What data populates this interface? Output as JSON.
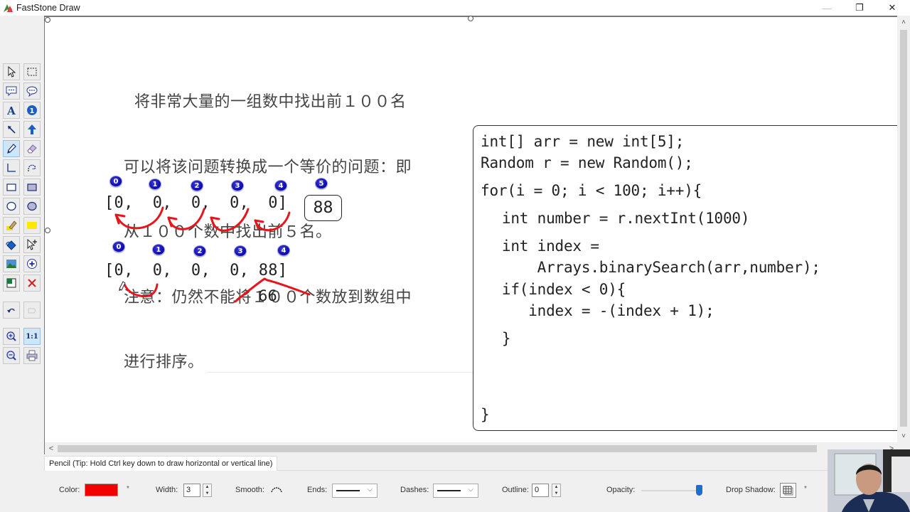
{
  "window": {
    "title": "FastStone Draw",
    "controls": {
      "minimize": "—",
      "restore": "❐",
      "close": "✕"
    }
  },
  "toolbar": {
    "tools": [
      {
        "name": "select-pointer-tool",
        "icon": "pointer-arrow-icon"
      },
      {
        "name": "rectangle-select-tool",
        "icon": "dashed-rect-select-icon"
      },
      {
        "name": "callout-rect-tool",
        "icon": "speech-bubble-rect-icon"
      },
      {
        "name": "callout-oval-tool",
        "icon": "speech-bubble-oval-icon"
      },
      {
        "name": "text-tool",
        "icon": "text-a-icon"
      },
      {
        "name": "numbered-step-tool",
        "icon": "info-circle-icon"
      },
      {
        "name": "arrow-tool",
        "icon": "diagonal-arrow-icon"
      },
      {
        "name": "block-arrow-tool",
        "icon": "up-arrow-icon"
      },
      {
        "name": "pencil-tool",
        "icon": "pencil-icon",
        "active": true
      },
      {
        "name": "eraser-tool",
        "icon": "eraser-icon"
      },
      {
        "name": "line-tool",
        "icon": "corner-line-icon"
      },
      {
        "name": "curve-tool",
        "icon": "curve-icon"
      },
      {
        "name": "rectangle-tool",
        "icon": "rectangle-outline-icon"
      },
      {
        "name": "filled-rectangle-tool",
        "icon": "rectangle-filled-icon"
      },
      {
        "name": "ellipse-tool",
        "icon": "ellipse-outline-icon"
      },
      {
        "name": "filled-ellipse-tool",
        "icon": "ellipse-filled-icon"
      },
      {
        "name": "highlighter-tool",
        "icon": "highlighter-icon"
      },
      {
        "name": "highlight-rect-tool",
        "icon": "yellow-rect-icon"
      },
      {
        "name": "fill-bucket-tool",
        "icon": "paint-bucket-icon"
      },
      {
        "name": "add-select-tool",
        "icon": "pointer-plus-icon"
      },
      {
        "name": "insert-image-tool",
        "icon": "image-icon"
      },
      {
        "name": "add-object-tool",
        "icon": "plus-circle-icon"
      },
      {
        "name": "canvas-color-tool",
        "icon": "canvas-color-icon"
      },
      {
        "name": "delete-tool",
        "icon": "red-x-icon"
      },
      {
        "name": "undo-button",
        "icon": "undo-icon"
      },
      {
        "name": "redo-button",
        "icon": "redo-icon",
        "disabled": true
      },
      {
        "name": "zoom-in-button",
        "icon": "zoom-in-icon"
      },
      {
        "name": "actual-size-button",
        "icon": "one-to-one-icon",
        "label": "1:1",
        "active": true
      },
      {
        "name": "zoom-out-button",
        "icon": "zoom-out-icon"
      },
      {
        "name": "print-button",
        "icon": "printer-icon"
      }
    ]
  },
  "canvas": {
    "description_lines": [
      "  将非常大量的一组数中找出前１００名",
      "可以将该问题转换成一个等价的问题：即",
      "从１００个数中找出前５名。",
      "注意：仍然不能将１００个数放到数组中",
      "进行排序。"
    ],
    "top_array": {
      "text": "[0,  0,  0,  0,  0]",
      "index_badges": [
        "0",
        "1",
        "2",
        "3",
        "4",
        "5"
      ],
      "boxed_value": "88"
    },
    "bottom_array": {
      "text": "[0,  0,  0,  0, 88]",
      "index_badges": [
        "0",
        "1",
        "2",
        "3",
        "4"
      ],
      "annotation_value": "66"
    },
    "code_lines": [
      "int[] arr = new int[5];",
      "Random r = new Random();",
      "for(i = 0; i < 100; i++){",
      "  int number = r.nextInt(1000)",
      "  int index =",
      "      Arrays.binarySearch(arr,number);",
      "  if(index < 0){",
      "     index = -(index + 1);",
      "  }",
      "}"
    ],
    "ink_color": "#e8141c"
  },
  "scrollbars": {
    "up_arrow": "˄",
    "down_arrow": "˅",
    "left_arrow": "<",
    "right_arrow": ">"
  },
  "properties": {
    "tab_label": "Pencil (Tip: Hold Ctrl key down to draw horizontal or vertical line)",
    "color_label": "Color:",
    "color_value": "#f20000",
    "color_star": "*",
    "width_label": "Width:",
    "width_value": "3",
    "smooth_label": "Smooth:",
    "ends_label": "Ends:",
    "dashes_label": "Dashes:",
    "outline_label": "Outline:",
    "outline_value": "0",
    "opacity_label": "Opacity:",
    "opacity_percent": 100,
    "drop_shadow_label": "Drop Shadow:",
    "drop_shadow_star": "*"
  }
}
